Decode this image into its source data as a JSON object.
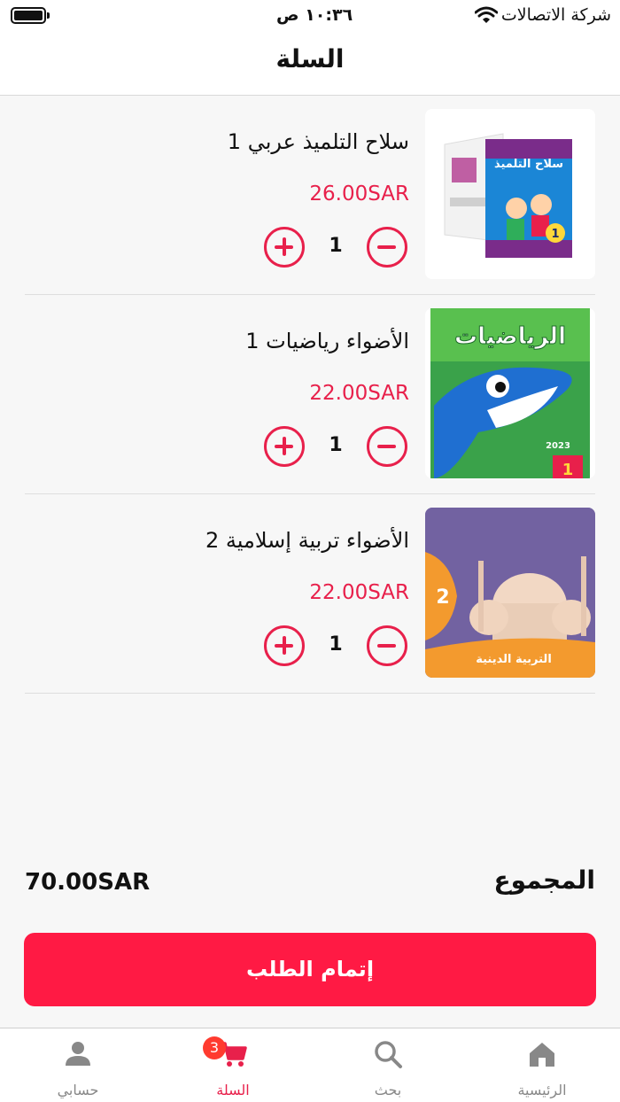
{
  "status_bar": {
    "time": "١٠:٣٦ ص",
    "carrier": "شركة الاتصالات"
  },
  "header": {
    "title": "السلة"
  },
  "cart": {
    "items": [
      {
        "name": "سلاح التلميذ عربي 1",
        "price": "26.00SAR",
        "quantity": "1",
        "cover_text": "سلاح التلميذ"
      },
      {
        "name": "الأضواء رياضيات 1",
        "price": "22.00SAR",
        "quantity": "1",
        "cover_text": "الرياضيات"
      },
      {
        "name": "الأضواء تربية إسلامية 2",
        "price": "22.00SAR",
        "quantity": "1",
        "cover_text": "التربية الدينية"
      }
    ]
  },
  "summary": {
    "total_label": "المجموع",
    "total_amount": "70.00SAR"
  },
  "checkout": {
    "label": "إتمام الطلب"
  },
  "bottom_nav": {
    "items": [
      {
        "label": "الرئيسية",
        "icon": "home-icon"
      },
      {
        "label": "بحث",
        "icon": "search-icon"
      },
      {
        "label": "السلة",
        "icon": "cart-icon",
        "badge": "3"
      },
      {
        "label": "حسابي",
        "icon": "person-icon"
      }
    ],
    "active_color": "#e8204b",
    "inactive_color": "#888888"
  },
  "colors": {
    "accent": "#ff1a44",
    "price": "#e8204b"
  }
}
